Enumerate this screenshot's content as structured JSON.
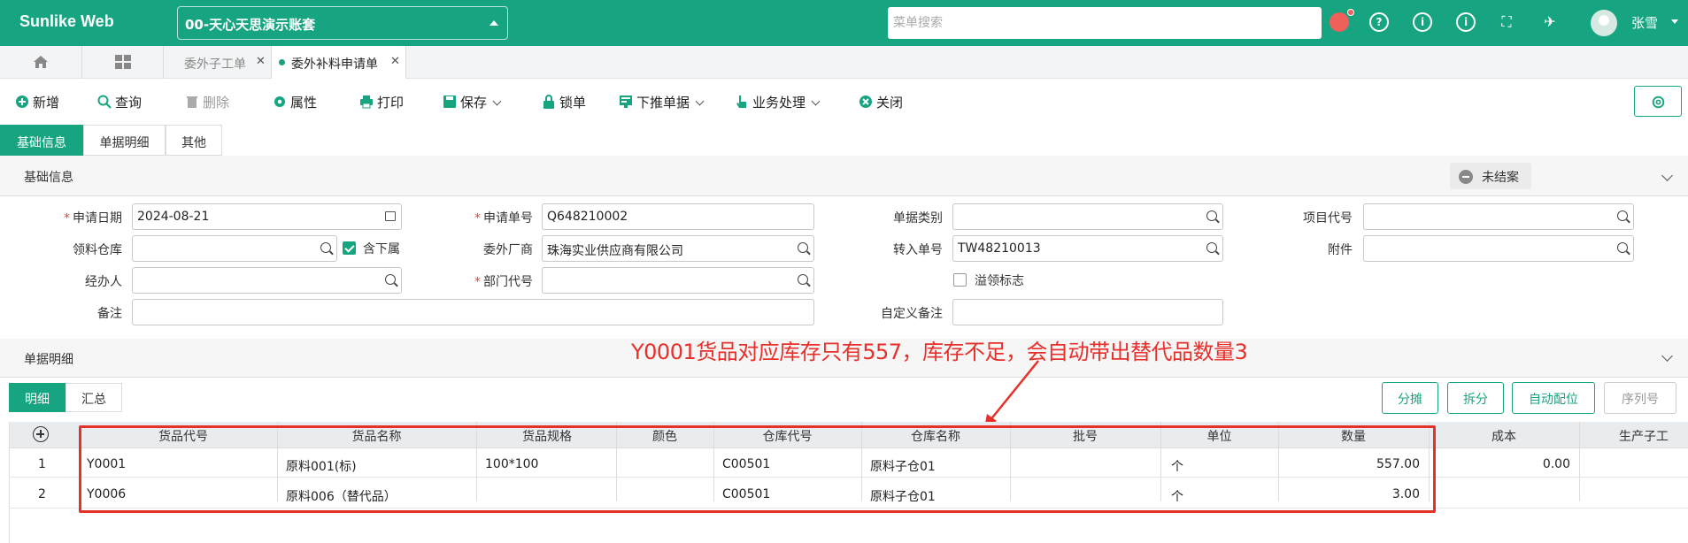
{
  "app": {
    "logo": "Sunlike Web",
    "account": "00-天心天思演示账套",
    "search_placeholder": "菜单搜索",
    "user": "张雪"
  },
  "tabs": [
    {
      "label": "委外子工单"
    },
    {
      "label": "委外补料申请单"
    }
  ],
  "toolbar": {
    "add": "新增",
    "query": "查询",
    "delete": "删除",
    "props": "属性",
    "print": "打印",
    "save": "保存",
    "lock": "锁单",
    "push": "下推单据",
    "business": "业务处理",
    "close": "关闭"
  },
  "section_tabs": [
    "基础信息",
    "单据明细",
    "其他"
  ],
  "basic": {
    "title": "基础信息",
    "status": "未结案",
    "fields": {
      "apply_date": {
        "label": "申请日期",
        "value": "2024-08-21"
      },
      "apply_no": {
        "label": "申请单号",
        "value": "Q648210002"
      },
      "doc_type": {
        "label": "单据类别",
        "value": ""
      },
      "project_code": {
        "label": "项目代号",
        "value": ""
      },
      "warehouse": {
        "label": "领料仓库",
        "value": ""
      },
      "include_sub": {
        "label": "含下属",
        "checked": true
      },
      "vendor": {
        "label": "委外厂商",
        "value": "珠海实业供应商有限公司"
      },
      "transfer_no": {
        "label": "转入单号",
        "value": "TW48210013"
      },
      "attachment": {
        "label": "附件",
        "value": ""
      },
      "handler": {
        "label": "经办人",
        "value": ""
      },
      "dept_code": {
        "label": "部门代号",
        "value": ""
      },
      "overflow": {
        "label": "溢领标志",
        "checked": false
      },
      "remark": {
        "label": "备注",
        "value": ""
      },
      "custom_remark": {
        "label": "自定义备注",
        "value": ""
      }
    }
  },
  "detail": {
    "title": "单据明细",
    "annotation": "Y0001货品对应库存只有557，库存不足，会自动带出替代品数量3",
    "subtabs": [
      "明细",
      "汇总"
    ],
    "buttons": {
      "split_share": "分摊",
      "split": "拆分",
      "auto_match": "自动配位",
      "serial": "序列号"
    },
    "columns": [
      "货品代号",
      "货品名称",
      "货品规格",
      "颜色",
      "仓库代号",
      "仓库名称",
      "批号",
      "单位",
      "数量",
      "成本",
      "生产子工"
    ],
    "rows": [
      {
        "no": "1",
        "code": "Y0001",
        "name": "原料001(标)",
        "spec": "100*100",
        "color": "",
        "wh_code": "C00501",
        "wh_name": "原料子仓01",
        "batch": "",
        "unit": "个",
        "qty": "557.00",
        "cost": "0.00"
      },
      {
        "no": "2",
        "code": "Y0006",
        "name": "原料006（替代品）",
        "spec": "",
        "color": "",
        "wh_code": "C00501",
        "wh_name": "原料子仓01",
        "batch": "",
        "unit": "个",
        "qty": "3.00",
        "cost": ""
      }
    ]
  },
  "colors": {
    "primary": "#17a581",
    "annotation": "#e8302a"
  }
}
